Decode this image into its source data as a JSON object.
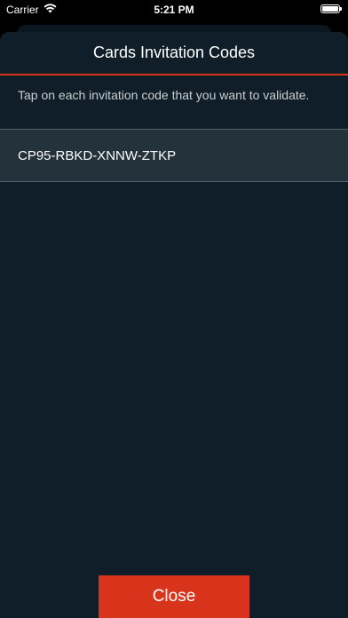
{
  "status_bar": {
    "carrier": "Carrier",
    "time": "5:21 PM",
    "wifi_icon": "wifi-icon",
    "battery_icon": "battery-icon",
    "battery_level": 1.0
  },
  "modal": {
    "title": "Cards Invitation Codes",
    "instructions": "Tap on each invitation code that you want to validate.",
    "codes": [
      {
        "code": "CP95-RBKD-XNNW-ZTKP"
      }
    ],
    "close_label": "Close"
  },
  "colors": {
    "accent": "#d8341c",
    "modal_background": "#0f1e28",
    "row_background": "#24323c",
    "screen_background": "#000000"
  }
}
